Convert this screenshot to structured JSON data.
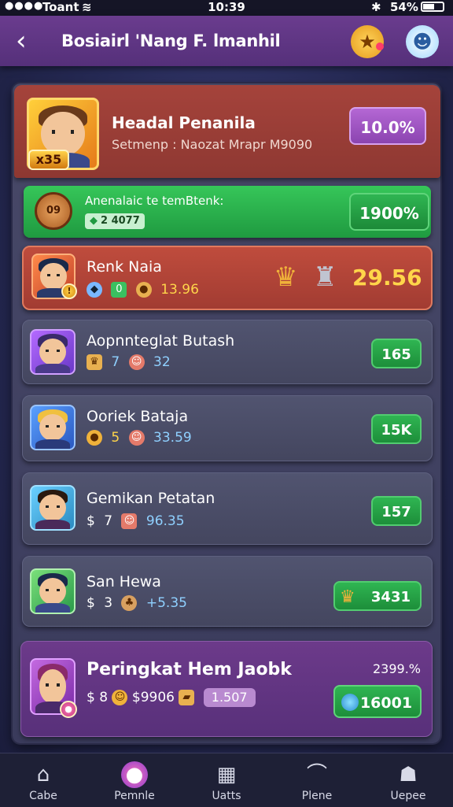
{
  "status_bar": {
    "carrier": "Toant",
    "time": "10:39",
    "battery": "54%"
  },
  "header": {
    "title": "Bosiairl 'Nang F. lmanhil"
  },
  "hero": {
    "name": "Headal Penanila",
    "subtitle": "Setmenp : Naozat Mrapr M9090",
    "level": "x35",
    "pill": "10.0%"
  },
  "green_bar": {
    "label": "Anenalaic te temBtenk:",
    "chip": "2 4077",
    "coin_text": "09",
    "pill": "1900%"
  },
  "you": {
    "name": "Renk Naia",
    "stat_a": "0",
    "stat_b": "13.96",
    "score": "29.56"
  },
  "rows": [
    {
      "name": "Aopnnteglat Butash",
      "a": "7",
      "b": "32",
      "pill": "165"
    },
    {
      "name": "Ooriek Bataja",
      "a": "5",
      "b": "33.59",
      "pill": "15K"
    },
    {
      "name": "Gemikan Petatan",
      "a": "7",
      "b": "96.35",
      "pill": "157"
    },
    {
      "name": "San Hewa",
      "a": "3",
      "b": "+5.35",
      "pill": "3431"
    }
  ],
  "footer_card": {
    "name": "Peringkat Hem Jaobk",
    "value": "2399.%",
    "stat_prefix": "8",
    "stat": "$9906",
    "chip": "1.507",
    "pill": "16001"
  },
  "tabs": [
    {
      "label": "Cabe",
      "icon": "home-icon"
    },
    {
      "label": "Pemnle",
      "icon": "orb-icon"
    },
    {
      "label": "Uatts",
      "icon": "building-icon"
    },
    {
      "label": "Plene",
      "icon": "hook-icon"
    },
    {
      "label": "Uepee",
      "icon": "user-icon"
    }
  ]
}
